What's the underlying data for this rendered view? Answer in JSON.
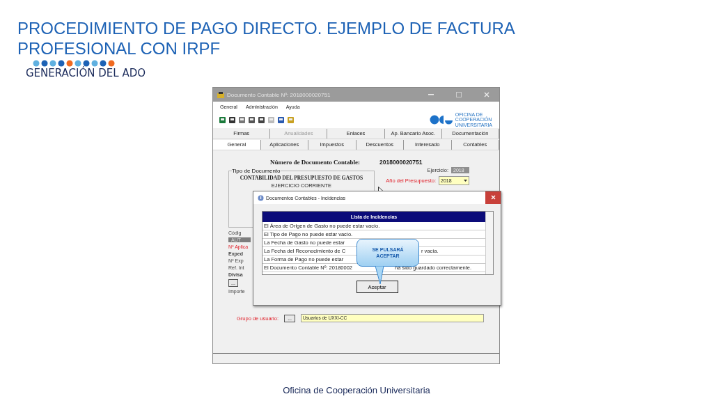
{
  "slide": {
    "title": "PROCEDIMIENTO DE PAGO DIRECTO. EJEMPLO DE FACTURA PROFESIONAL CON IRPF",
    "subtitle": "GENERACIÓN DEL ADO",
    "footer": "Oficina de Cooperación Universitaria"
  },
  "window": {
    "title": "Documento Contable Nº: 2018000020751",
    "menu": [
      "General",
      "Administración",
      "Ayuda"
    ],
    "logo_text": [
      "OFICINA DE",
      "COOPERACIÓN",
      "UNIVERSITARIA"
    ],
    "tabs_row_1": [
      {
        "label": "Firmas",
        "selected": false,
        "disabled": false
      },
      {
        "label": "Anualidades",
        "selected": false,
        "disabled": true
      },
      {
        "label": "Enlaces",
        "selected": false,
        "disabled": false
      },
      {
        "label": "Ap. Bancario Asoc.",
        "selected": false,
        "disabled": false
      },
      {
        "label": "Documentación",
        "selected": false,
        "disabled": false
      }
    ],
    "tabs_row_2": [
      {
        "label": "General",
        "selected": true,
        "disabled": false
      },
      {
        "label": "Aplicaciones",
        "selected": false,
        "disabled": false
      },
      {
        "label": "Impuestos",
        "selected": false,
        "disabled": false
      },
      {
        "label": "Descuentos",
        "selected": false,
        "disabled": false
      },
      {
        "label": "Interesado",
        "selected": false,
        "disabled": false
      },
      {
        "label": "Contables",
        "selected": false,
        "disabled": false
      }
    ],
    "doc_number_label": "Número de Documento Contable:",
    "doc_number": "2018000020751",
    "exercise_label": "Ejercicio:",
    "exercise_value": "2018",
    "doc_type_group": "Tipo de Documento",
    "doc_type_lines": [
      "CONTABILIDAD DEL PRESUPUESTO DE GASTOS",
      "EJERCICIO CORRIENTE"
    ],
    "budget_year_label": "Año del Presupuesto:",
    "budget_year_value": "2018",
    "fragments": [
      {
        "text": "Códig",
        "kind": "label"
      },
      {
        "text": "AUT",
        "kind": "greyfield"
      },
      {
        "text": "Nº Aplica",
        "kind": "red"
      },
      {
        "text": "Exped",
        "kind": "group"
      },
      {
        "text": "Nº Exp",
        "kind": "label"
      },
      {
        "text": "Ref. Int",
        "kind": "label"
      },
      {
        "text": "Divisa",
        "kind": "group"
      },
      {
        "text": "...",
        "kind": "button"
      },
      {
        "text": "Importe",
        "kind": "label"
      }
    ],
    "user_group_label": "Grupo de usuario:",
    "user_group_button": "...",
    "user_group_value": "Usuarios de UXXI-CC"
  },
  "dialog": {
    "title": "Documentos Contables - Incidencias",
    "list_header": "Lista de Incidencias",
    "rows": [
      {
        "parts": [
          "El Área de Origen de Gasto no puede estar vacío."
        ]
      },
      {
        "parts": [
          "El Tipo de Pago no puede estar vacío."
        ]
      },
      {
        "parts": [
          "La Fecha de Gasto no puede estar"
        ]
      },
      {
        "parts": [
          "La Fecha del Reconocimiento de C",
          "r vacía."
        ]
      },
      {
        "parts": [
          "La Forma de Pago no puede estar"
        ]
      },
      {
        "parts": [
          "El Documento Contable Nº: 20180002",
          "ha sido guardado correctamente."
        ]
      }
    ],
    "button": "Aceptar",
    "callout": "SE PULSARÁ ACEPTAR"
  }
}
